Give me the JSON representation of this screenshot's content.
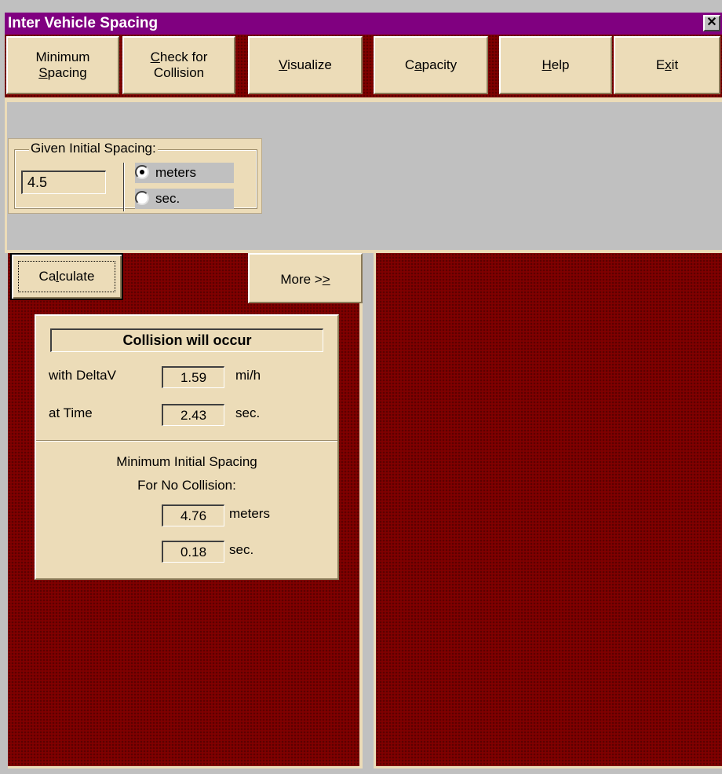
{
  "window": {
    "title": "Inter Vehicle Spacing",
    "close_glyph": "✕"
  },
  "menu": {
    "minimum_spacing": {
      "line1": "Minimum",
      "line2_prefix": "",
      "line2_u": "S",
      "line2_rest": "pacing"
    },
    "check_collision": {
      "line1_u": "C",
      "line1_rest": "heck for",
      "line2": "Collision"
    },
    "visualize": {
      "u": "V",
      "rest": "isualize"
    },
    "capacity": {
      "pre": "C",
      "u": "a",
      "rest": "pacity"
    },
    "help": {
      "u": "H",
      "rest": "elp"
    },
    "exit": {
      "pre": "E",
      "u": "x",
      "rest": "it"
    }
  },
  "initial_spacing": {
    "legend": "Given Initial Spacing:",
    "value": "4.5",
    "unit_meters": "meters",
    "unit_sec": "sec.",
    "selected": "meters"
  },
  "buttons": {
    "calculate": {
      "pre": "Ca",
      "u": "l",
      "rest": "culate"
    },
    "more": {
      "pre": "More >",
      "u": ">"
    }
  },
  "result": {
    "status": "Collision will occur",
    "deltav_label": "with DeltaV",
    "deltav_value": "1.59",
    "deltav_unit": "mi/h",
    "time_label": "at Time",
    "time_value": "2.43",
    "time_unit": "sec.",
    "min_spacing_heading_1": "Minimum Initial Spacing",
    "min_spacing_heading_2": "For No Collision:",
    "min_spacing_meters": "4.76",
    "min_spacing_meters_unit": "meters",
    "min_spacing_sec": "0.18",
    "min_spacing_sec_unit": "sec."
  },
  "colors": {
    "titlebar": "#800080",
    "panel_maroon": "#800000",
    "button_beige": "#ecdcb8",
    "background_grey": "#c0c0c0"
  }
}
